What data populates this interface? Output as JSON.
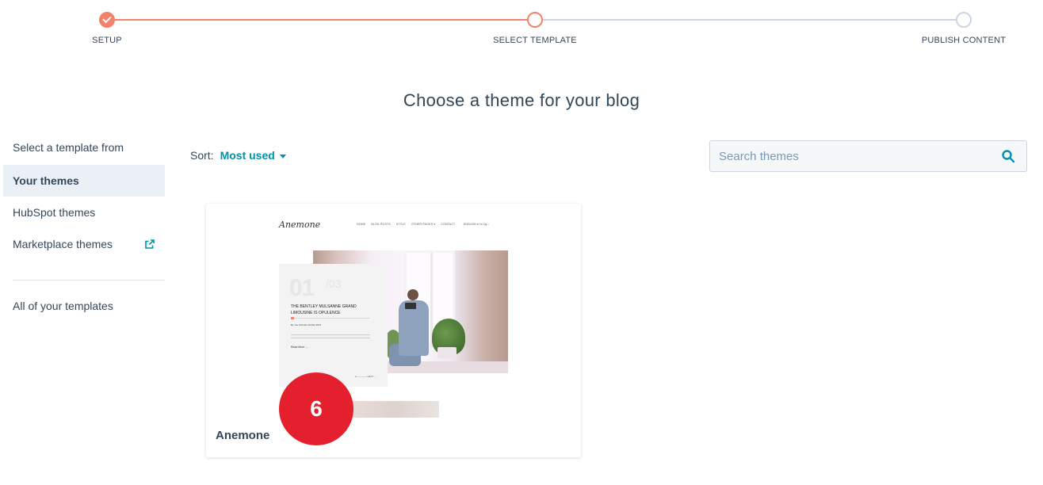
{
  "stepper": {
    "steps": [
      {
        "label": "SETUP",
        "state": "completed"
      },
      {
        "label": "SELECT TEMPLATE",
        "state": "active"
      },
      {
        "label": "PUBLISH CONTENT",
        "state": "pending"
      }
    ],
    "completed_color": "#f2826b",
    "pending_color": "#cbd6e2"
  },
  "page_title": "Choose a theme for your blog",
  "sidebar": {
    "heading": "Select a template from",
    "items": [
      {
        "label": "Your themes",
        "active": true
      },
      {
        "label": "HubSpot themes",
        "active": false
      },
      {
        "label": "Marketplace themes",
        "active": false,
        "icon": "external-link-icon"
      }
    ],
    "footer_link": "All of your templates"
  },
  "sort": {
    "label": "Sort:",
    "value": "Most used"
  },
  "search": {
    "placeholder": "Search themes",
    "value": "",
    "icon": "search-icon"
  },
  "themes": [
    {
      "name": "Anemone",
      "preview": {
        "logo": "Anemone",
        "nav": [
          "HOME",
          "BLOG POSTS",
          "STYLE",
          "OTHER PAGES ▾",
          "CONTACT"
        ],
        "util": "ENGLISH ▾  f  in  t  ig  ⌕",
        "slide_number": "01",
        "slide_total": "/03",
        "headline": "THE BENTLEY MULSANNE GRAND LIMOUSINE IS OPULENCE",
        "author": "By Joe Nicholls    20 Mar 2019",
        "read_more": "Read More  →",
        "pager": "● ———— \nNEXT  →"
      }
    }
  ],
  "overlay_badge": "6",
  "colors": {
    "accent": "#0091ae",
    "text": "#33475b",
    "badge": "#e5202e"
  }
}
